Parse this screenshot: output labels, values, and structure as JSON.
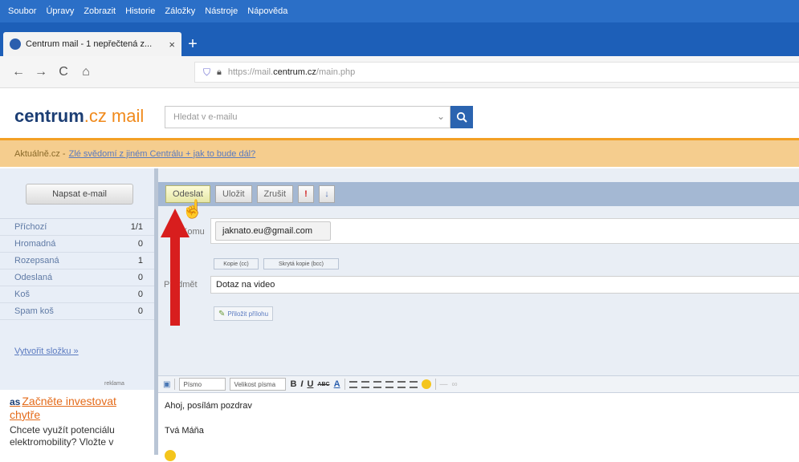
{
  "menu": [
    "Soubor",
    "Úpravy",
    "Zobrazit",
    "Historie",
    "Záložky",
    "Nástroje",
    "Nápověda"
  ],
  "tab": {
    "title": "Centrum mail - 1 nepřečtená z...",
    "close": "×",
    "new": "+"
  },
  "nav": {
    "back": "←",
    "forward": "→",
    "reload": "C",
    "home": "⌂",
    "url_prefix": "https://mail.",
    "url_domain": "centrum.cz",
    "url_path": "/main.php"
  },
  "site": {
    "logo_brand": "centrum",
    "logo_cz": ".cz",
    "logo_mail": "mail",
    "search_placeholder": "Hledat v e-mailu",
    "search_icon": "search-icon"
  },
  "banner": {
    "source": "Aktuálně.cz -",
    "link": "Zlé svědomí z jiném Centrálu + jak to bude dál?"
  },
  "sidebar": {
    "compose_label": "Napsat e-mail",
    "folders": [
      {
        "name": "Příchozí",
        "count": "1/1"
      },
      {
        "name": "Hromadná",
        "count": "0"
      },
      {
        "name": "Rozepsaná",
        "count": "1"
      },
      {
        "name": "Odeslaná",
        "count": "0"
      },
      {
        "name": "Koš",
        "count": "0"
      },
      {
        "name": "Spam koš",
        "count": "0"
      }
    ],
    "new_folder": "Vytvořit složku »",
    "ad_label": "reklama",
    "ad_badge": "as",
    "ad_title": "Začněte investovat chytře",
    "ad_text": "Chcete využít potenciálu elektromobility? Vložte v"
  },
  "toolbar": {
    "send": "Odeslat",
    "save": "Uložit",
    "cancel": "Zrušit",
    "prio_high": "!",
    "prio_low": "↓"
  },
  "compose": {
    "to_label": "Komu",
    "recipient": "jaknato.eu@gmail.com",
    "copy_btn": "Kopie (cc)",
    "bcc_btn": "Skrytá kopie (bcc)",
    "subject_label": "Předmět",
    "subject": "Dotaz na video",
    "attach": "Přiložit přílohu"
  },
  "editor": {
    "font": "Písmo",
    "size": "Velikost písma",
    "bold": "B",
    "italic": "I",
    "underline": "U",
    "strike": "ABC",
    "color": "A",
    "body_line1": "Ahoj, posílám pozdrav",
    "body_line2": "Tvá Máňa"
  }
}
